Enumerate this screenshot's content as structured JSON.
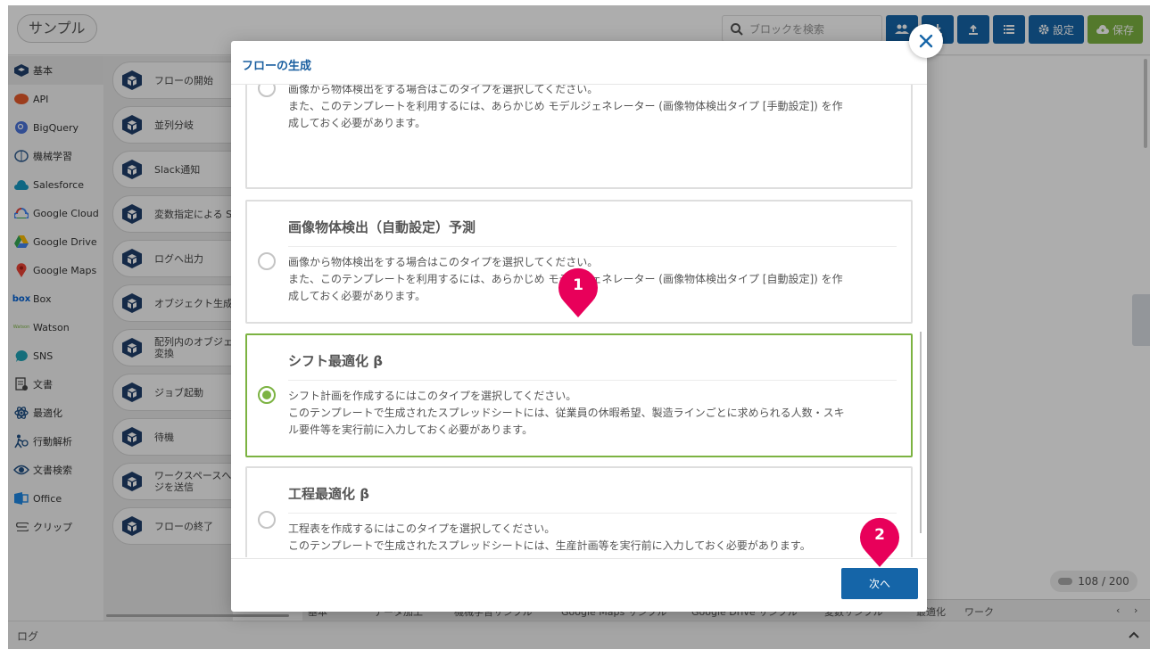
{
  "app": {
    "title": "サンプル",
    "search_placeholder": "ブロックを検索",
    "toolbar": {
      "settings_label": "設定",
      "save_label": "保存"
    }
  },
  "sidebar": {
    "categories": [
      {
        "label": "基本",
        "icon": "basic-cube-icon"
      },
      {
        "label": "API",
        "icon": "api-icon"
      },
      {
        "label": "BigQuery",
        "icon": "bigquery-icon"
      },
      {
        "label": "機械学習",
        "icon": "brain-icon"
      },
      {
        "label": "Salesforce",
        "icon": "cloud-icon"
      },
      {
        "label": "Google Cloud",
        "icon": "google-cloud-icon"
      },
      {
        "label": "Google Drive",
        "icon": "google-drive-icon"
      },
      {
        "label": "Google Maps",
        "icon": "map-pin-icon"
      },
      {
        "label": "Box",
        "icon": "box-logo"
      },
      {
        "label": "Watson",
        "icon": "watson-logo"
      },
      {
        "label": "SNS",
        "icon": "chat-bubble-icon"
      },
      {
        "label": "文書",
        "icon": "document-icon"
      },
      {
        "label": "最適化",
        "icon": "atom-icon"
      },
      {
        "label": "行動解析",
        "icon": "person-run-icon"
      },
      {
        "label": "文書検索",
        "icon": "document-search-icon"
      },
      {
        "label": "Office",
        "icon": "office-icon"
      },
      {
        "label": "クリップ",
        "icon": "paperclip-icon"
      }
    ],
    "box_logo_text": "box",
    "watson_logo_text": "Watson"
  },
  "blocks": [
    {
      "label": "フローの開始"
    },
    {
      "label": "並列分岐"
    },
    {
      "label": "Slack通知"
    },
    {
      "label": "変数指定による S"
    },
    {
      "label": "ログへ出力"
    },
    {
      "label": "オブジェクト生成"
    },
    {
      "label": "配列内のオブジェ",
      "label2": "変換"
    },
    {
      "label": "ジョブ起動"
    },
    {
      "label": "待機"
    },
    {
      "label": "ワークスペースへ",
      "label2": "ジを送信"
    },
    {
      "label": "フローの終了"
    }
  ],
  "canvas": {
    "counter": "108 / 200"
  },
  "tabs": [
    "基本",
    "データ加工",
    "機械学習サンプル",
    "Google Maps サンプル",
    "Google Drive サンプル",
    "変数サンプル",
    "最適化",
    "ワーク"
  ],
  "log": {
    "label": "ログ"
  },
  "modal": {
    "title": "フローの生成",
    "cards": [
      {
        "title": "",
        "desc": [
          "画像から物体検出をする場合はこのタイプを選択してください。",
          "また、このテンプレートを利用するには、あらかじめ モデルジェネレーター (画像物体検出タイプ [手動設定]) を作",
          "成しておく必要があります。"
        ],
        "selected": false
      },
      {
        "title": "画像物体検出（自動設定）予測",
        "desc": [
          "画像から物体検出をする場合はこのタイプを選択してください。",
          "また、このテンプレートを利用するには、あらかじめ モデルジェネレーター (画像物体検出タイプ [自動設定]) を作",
          "成しておく必要があります。"
        ],
        "selected": false
      },
      {
        "title": "シフト最適化 β",
        "desc": [
          "シフト計画を作成するにはこのタイプを選択してください。",
          "このテンプレートで生成されたスプレッドシートには、従業員の休暇希望、製造ラインごとに求められる人数・スキ",
          "ル要件等を実行前に入力しておく必要があります。"
        ],
        "selected": true
      },
      {
        "title": "工程最適化 β",
        "desc": [
          "工程表を作成するにはこのタイプを選択してください。",
          "このテンプレートで生成されたスプレッドシートには、生産計画等を実行前に入力しておく必要があります。"
        ],
        "selected": false
      }
    ],
    "next_label": "次へ"
  },
  "markers": [
    "1",
    "2"
  ],
  "colors": {
    "primary": "#1565a8",
    "accent_green": "#7cb342",
    "marker_pink": "#e8005a",
    "title_blue": "#1a5fa0"
  }
}
